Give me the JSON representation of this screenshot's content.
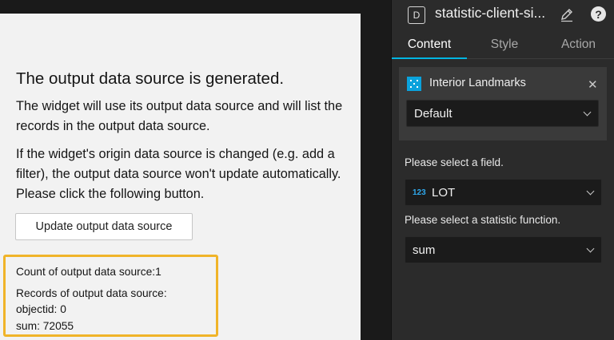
{
  "widget": {
    "title": "The output data source is generated.",
    "para1": "The widget will use its output data source and will list the records in the output data source.",
    "para2": "If the widget's origin data source is changed (e.g. add a filter), the output data source won't update automatically. Please click the following button.",
    "update_button": "Update output data source",
    "result": {
      "count_line": "Count of output data source:1",
      "records_label": "Records of output data source:",
      "record_lines": [
        "objectid: 0",
        "sum: 72055"
      ]
    },
    "highlight_color": "#f0b429"
  },
  "panel": {
    "badge": "D",
    "title": "statistic-client-si...",
    "tabs": [
      {
        "label": "Content",
        "active": true
      },
      {
        "label": "Style",
        "active": false
      },
      {
        "label": "Action",
        "active": false
      }
    ],
    "accent_color": "#00b5e2",
    "data_source": {
      "name": "Interior Landmarks",
      "close_icon": "close-icon",
      "view": "Default"
    },
    "field_label": "Please select a field.",
    "field": {
      "type_badge": "123",
      "value": "LOT"
    },
    "stat_label": "Please select a statistic function.",
    "stat_value": "sum"
  }
}
